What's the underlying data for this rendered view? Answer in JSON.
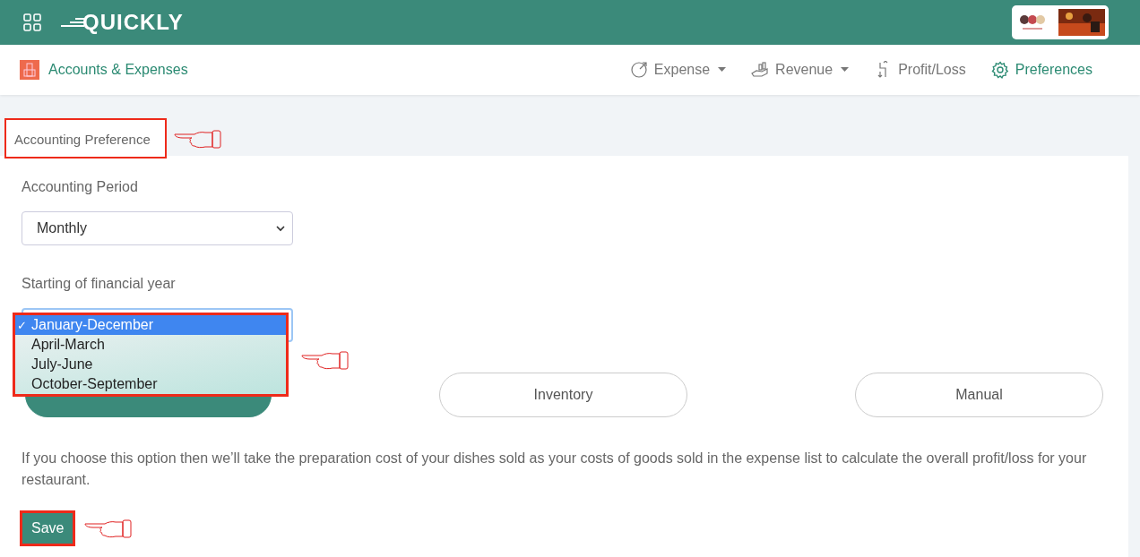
{
  "topbar": {
    "logo": "QUICKLY"
  },
  "module": {
    "title": "Accounts & Expenses"
  },
  "nav": [
    {
      "label": "Expense",
      "dropdown": true,
      "selected": false
    },
    {
      "label": "Revenue",
      "dropdown": true,
      "selected": false
    },
    {
      "label": "Profit/Loss",
      "dropdown": false,
      "selected": false
    },
    {
      "label": "Preferences",
      "dropdown": false,
      "selected": true
    }
  ],
  "section": {
    "title": "Accounting Preference",
    "highlighted": true,
    "pointer": true
  },
  "accounting_period": {
    "label": "Accounting Period",
    "value": "Monthly"
  },
  "financial_year": {
    "label": "Starting of financial year",
    "expanded": true,
    "highlighted": true,
    "pointer": true,
    "check": "✓",
    "options": [
      {
        "label": "January-December",
        "selected": true
      },
      {
        "label": "April-March",
        "selected": false
      },
      {
        "label": "July-June",
        "selected": false
      },
      {
        "label": "October-September",
        "selected": false
      }
    ]
  },
  "cost_methods": [
    {
      "selected": true
    },
    {
      "label": "Inventory",
      "selected": false
    },
    {
      "label": "Manual",
      "selected": false
    }
  ],
  "description": "If you choose this option then we’ll take the preparation cost of your dishes sold as your costs of goods sold in the expense list to calculate the overall profit/loss for your restaurant.",
  "save": {
    "label": "Save",
    "highlighted": true,
    "pointer": true
  }
}
